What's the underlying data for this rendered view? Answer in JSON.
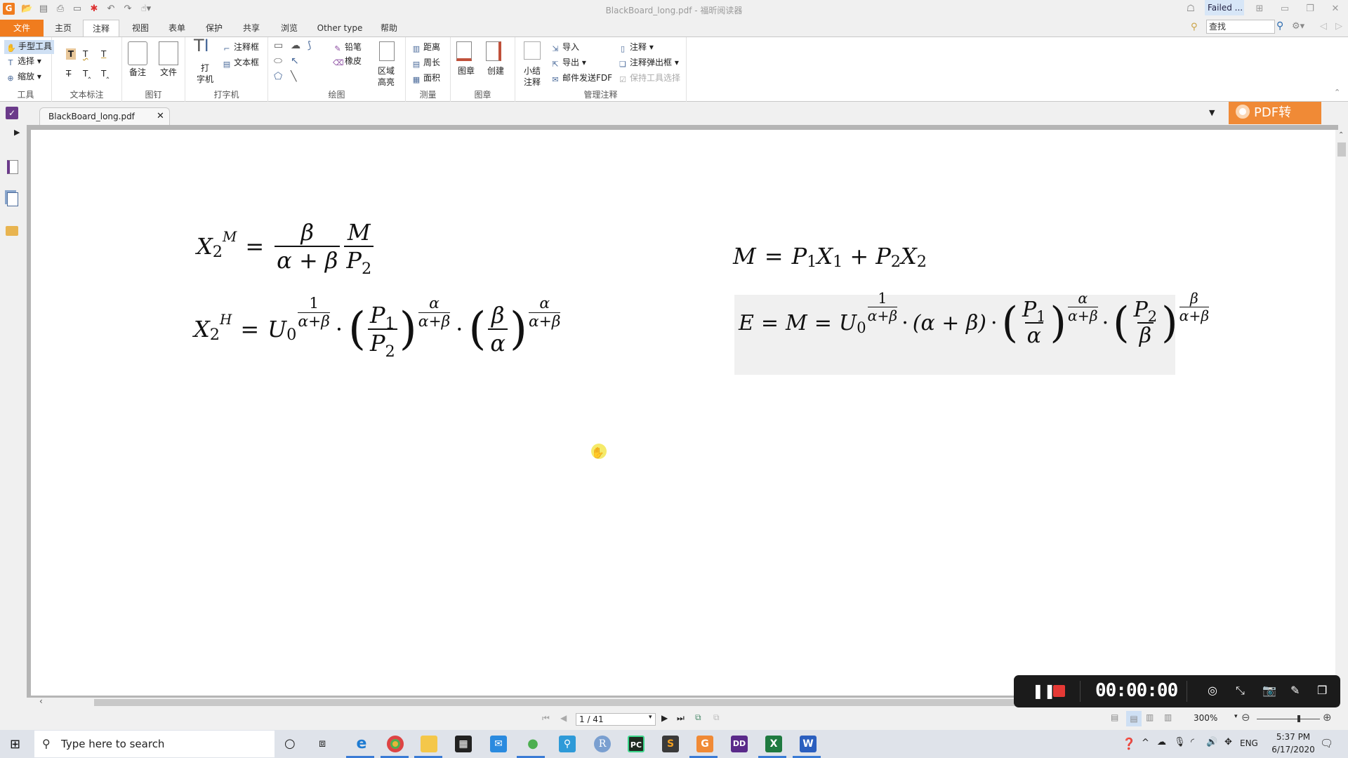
{
  "window": {
    "title": "BlackBoard_long.pdf - 福昕阅读器",
    "failed_label": "Failed ...",
    "search_placeholder": "查找"
  },
  "menu_tabs": [
    "文件",
    "主页",
    "注释",
    "视图",
    "表单",
    "保护",
    "共享",
    "浏览",
    "Other type",
    "帮助"
  ],
  "active_menu_tab": "注释",
  "ribbon": {
    "tools": {
      "label": "工具",
      "hand": "手型工具",
      "select": "选择",
      "zoom": "缩放"
    },
    "text_markup": {
      "label": "文本标注"
    },
    "pin": {
      "label": "图钉",
      "note": "备注",
      "file": "文件"
    },
    "typewriter": {
      "label": "打字机",
      "typewriter_line1": "打",
      "typewriter_line2": "字机",
      "callout": "注释框",
      "textbox": "文本框"
    },
    "drawing": {
      "label": "绘图",
      "pencil": "铅笔",
      "eraser": "橡皮",
      "area_hl_1": "区域",
      "area_hl_2": "高亮"
    },
    "measure": {
      "label": "测量",
      "distance": "距离",
      "perimeter": "周长",
      "area": "面积"
    },
    "stamp": {
      "label": "图章",
      "stamp": "图章",
      "create": "创建"
    },
    "manage": {
      "label": "管理注释",
      "summary_1": "小结",
      "summary_2": "注释",
      "import": "导入",
      "export": "导出",
      "email_fdf": "邮件发送FDF",
      "comments": "注释",
      "popup": "注释弹出框",
      "keep_tool": "保持工具选择"
    }
  },
  "doc_tab": {
    "name": "BlackBoard_long.pdf"
  },
  "promo_button": "PDF转Word",
  "equations": {
    "eq1": {
      "lhs": "X",
      "lhs_sub": "2",
      "lhs_sup": "M",
      "frac1_num": "β",
      "frac1_den": "α + β",
      "frac2_num": "M",
      "frac2_den": "P",
      "frac2_den_sub": "2"
    },
    "eq2": {
      "lhs": "X",
      "lhs_sub": "2",
      "lhs_sup": "H",
      "u": "U",
      "u_sub": "0",
      "u_exp_num": "1",
      "u_exp_den": "α+β",
      "p_num": "P",
      "p_num_sub": "1",
      "p_den": "P",
      "p_den_sub": "2",
      "p_exp_num": "α",
      "p_exp_den": "α+β",
      "b_num": "β",
      "b_den": "α",
      "b_exp_num": "α",
      "b_exp_den": "α+β"
    },
    "eq3": {
      "text_m": "M",
      "p1": "P",
      "p1_sub": "1",
      "x1": "X",
      "x1_sub": "1",
      "p2": "P",
      "p2_sub": "2",
      "x2": "X",
      "x2_sub": "2"
    },
    "eq4": {
      "e": "E",
      "m": "M",
      "u": "U",
      "u_sub": "0",
      "u_exp_num": "1",
      "u_exp_den": "α+β",
      "sum": "(α + β)",
      "p1_num": "P",
      "p1_num_sub": "1",
      "p1_den": "α",
      "p1_exp_num": "α",
      "p1_exp_den": "α+β",
      "p2_num": "P",
      "p2_num_sub": "2",
      "p2_den": "β",
      "p2_exp_num": "β",
      "p2_exp_den": "α+β"
    }
  },
  "recorder": {
    "time": "00:00:00"
  },
  "status": {
    "page": "1 / 41",
    "zoom": "300%"
  },
  "taskbar": {
    "search_placeholder": "Type here to search",
    "time": "5:37 PM",
    "date": "6/17/2020",
    "lang": "ENG"
  }
}
